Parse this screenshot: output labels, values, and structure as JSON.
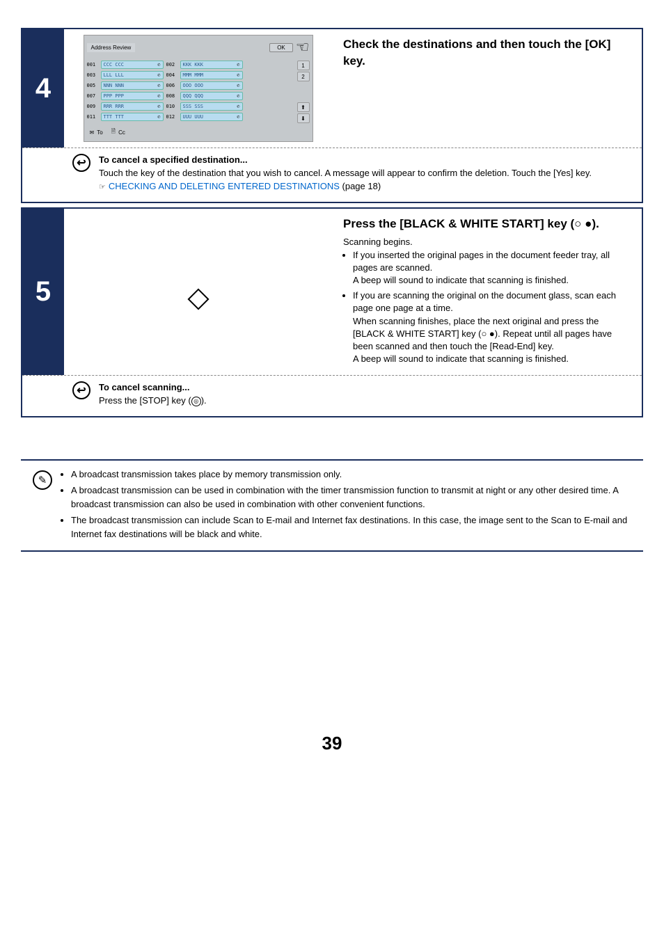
{
  "step4": {
    "number": "4",
    "heading": "Check the destinations and then touch the [OK] key.",
    "panel": {
      "title": "Address Review",
      "ok": "OK",
      "rows": [
        {
          "l_num": "001",
          "l_label": "CCC CCC",
          "r_num": "002",
          "r_label": "KKK KKK"
        },
        {
          "l_num": "003",
          "l_label": "LLL LLL",
          "r_num": "004",
          "r_label": "MMM MMM"
        },
        {
          "l_num": "005",
          "l_label": "NNN NNN",
          "r_num": "006",
          "r_label": "OOO OOO"
        },
        {
          "l_num": "007",
          "l_label": "PPP PPP",
          "r_num": "008",
          "r_label": "QQQ QQQ"
        },
        {
          "l_num": "009",
          "l_label": "RRR RRR",
          "r_num": "010",
          "r_label": "SSS SSS"
        },
        {
          "l_num": "011",
          "l_label": "TTT TTT",
          "r_num": "012",
          "r_label": "UUU UUU"
        }
      ],
      "scroll": {
        "page_cur": "1",
        "page_total": "2",
        "up": "⬆",
        "down": "⬇"
      },
      "footer": {
        "to_icon": "✉",
        "to": "To",
        "cc_icon": "🗎",
        "cc": "Cc"
      }
    },
    "cancel": {
      "title": "To cancel a specified destination...",
      "body": "Touch the key of the destination that you wish to cancel. A message will appear to confirm the deletion. Touch the [Yes] key.",
      "link_icon": "☞",
      "link": "CHECKING AND DELETING ENTERED DESTINATIONS",
      "link_page": " (page 18)"
    }
  },
  "step5": {
    "number": "5",
    "heading_a": "Press the [BLACK & WHITE START] key (",
    "heading_b": ").",
    "scan_begins": "Scanning begins.",
    "bullets": {
      "b1a": "If you inserted the original pages in the document feeder tray, all pages are scanned.",
      "b1b": "A beep will sound to indicate that scanning is finished.",
      "b2a": "If you are scanning the original on the document glass, scan each page one page at a time.",
      "b2b": "When scanning finishes, place the next original and press the [BLACK & WHITE START] key (",
      "b2c": "). Repeat until all pages have been scanned and then touch the [Read-End] key.",
      "b2d": "A beep will sound to indicate that scanning is finished."
    },
    "cancel": {
      "title": "To cancel scanning...",
      "body_a": "Press the [STOP] key (",
      "body_b": ")."
    }
  },
  "notes": {
    "n1": "A broadcast transmission takes place by memory transmission only.",
    "n2": "A broadcast transmission can be used in combination with the timer transmission function to transmit at night or any other desired time. A broadcast transmission can also be used in combination with other convenient functions.",
    "n3": "The broadcast transmission can include Scan to E-mail and Internet fax destinations. In this case, the image sent to the Scan to E-mail and Internet fax destinations will be black and white."
  },
  "page_number": "39"
}
